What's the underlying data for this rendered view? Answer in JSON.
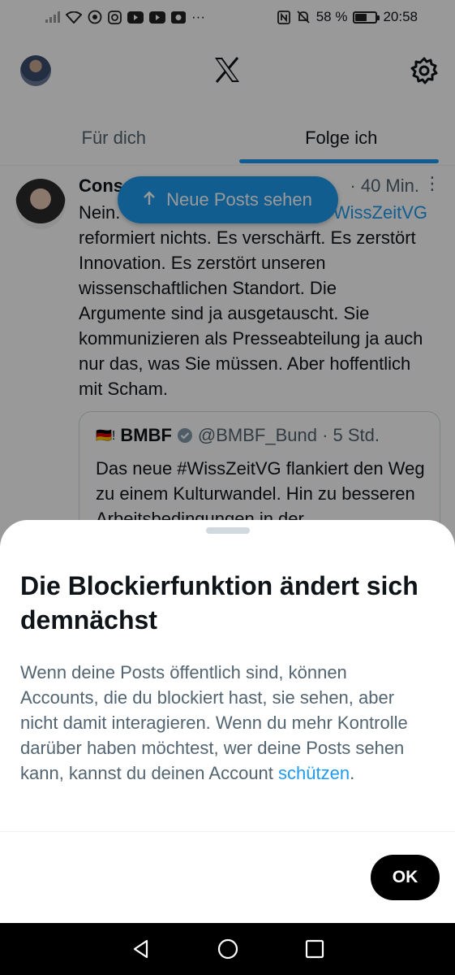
{
  "status_bar": {
    "battery": "58 %",
    "battery_level": 0.58,
    "time": "20:58",
    "more": "···"
  },
  "header": {
    "logo": "x-logo-icon",
    "settings_icon": "gear-icon"
  },
  "tabs": [
    {
      "label": "Für dich",
      "active": false
    },
    {
      "label": "Folge ich",
      "active": true
    }
  ],
  "new_posts_pill": {
    "label": "Neue Posts sehen",
    "icon": "arrow-up-icon"
  },
  "post": {
    "name_fragment": "Cons",
    "time": "· 40 Min.",
    "text_line1_start": "Nein.",
    "text_line1_end": "#WissZeitVG",
    "text_rest": "reformiert nichts. Es verschärft. Es zerstört Innovation. Es zerstört unseren wissenschaftlichen Standort. Die Argumente sind ja ausgetauscht. Sie kommunizieren als Presseabteilung ja auch nur das, was Sie müssen. Aber hoffentlich mit Scham.",
    "quote": {
      "flag": "🇩🇪!",
      "name": "BMBF",
      "handle": "@BMBF_Bund · 5 Std.",
      "text": "Das neue #WissZeitVG flankiert den Weg zu einem Kulturwandel. Hin zu besseren Arbeitsbedingungen in der"
    }
  },
  "sheet": {
    "title": "Die Blockierfunktion ändert sich demnächst",
    "body": "Wenn deine Posts öffentlich sind, können Accounts, die du blockiert hast, sie sehen, aber nicht damit interagieren. Wenn du mehr Kontrolle darüber haben möchtest, wer deine Posts sehen kann, kannst du deinen Account ",
    "link": "schützen",
    "body_end": ".",
    "ok_label": "OK"
  },
  "colors": {
    "accent": "#1d9bf0",
    "text": "#0f1419",
    "secondary": "#536471"
  }
}
